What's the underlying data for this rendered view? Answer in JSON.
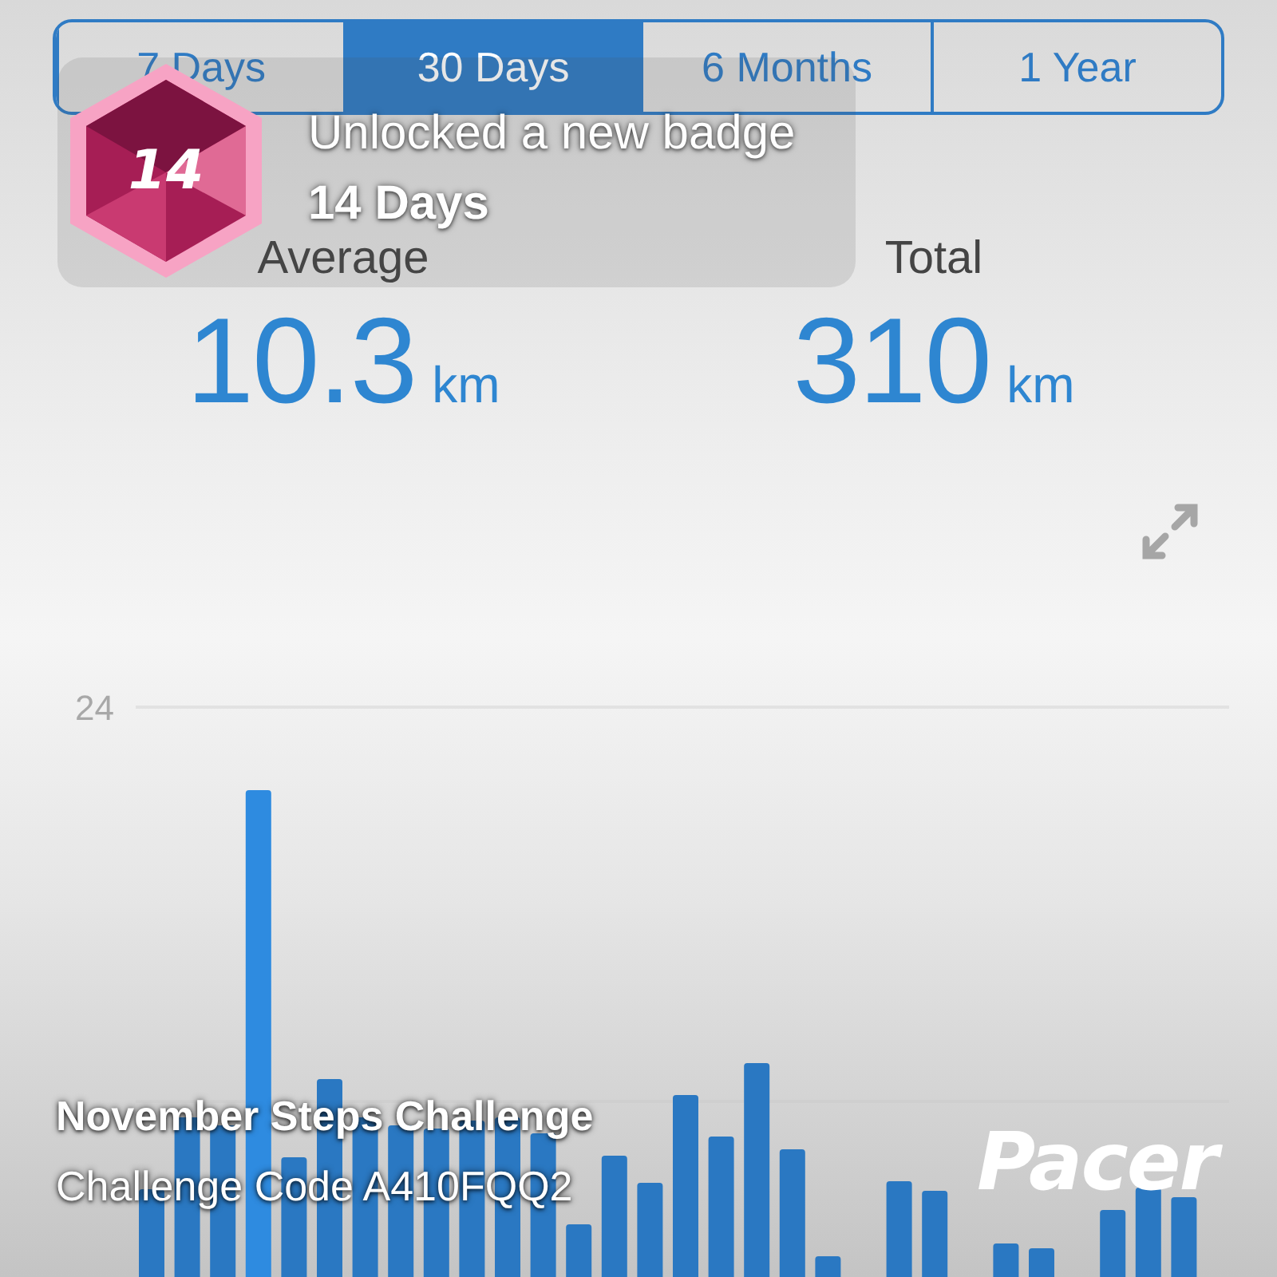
{
  "tabs": [
    {
      "label": "7 Days",
      "selected": false
    },
    {
      "label": "30 Days",
      "selected": true
    },
    {
      "label": "6 Months",
      "selected": false
    },
    {
      "label": "1 Year",
      "selected": false
    }
  ],
  "badge_notification": {
    "badge_number": "14",
    "message": "Unlocked a new badge",
    "badge_name": "14 Days"
  },
  "stats": [
    {
      "label": "Average",
      "value": "10.3",
      "unit": "km"
    },
    {
      "label": "Total",
      "value": "310",
      "unit": "km"
    }
  ],
  "chart": {
    "y_tick_labels": [
      "24"
    ]
  },
  "challenge": {
    "title": "November Steps Challenge",
    "code": "Challenge Code A410FQQ2"
  },
  "logo": "Pacer"
}
